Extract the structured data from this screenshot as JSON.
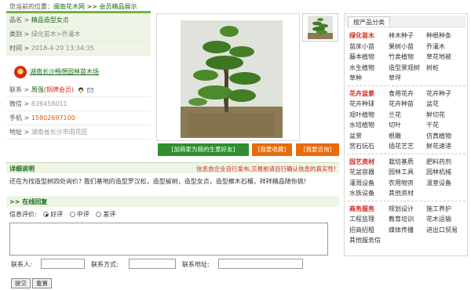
{
  "breadcrumb": {
    "label": "您当前的位置：",
    "site": "闽南花木网",
    "sep": " >> ",
    "current": "会员精品展示"
  },
  "product": {
    "name_key": "品名 >",
    "name_val": "精品造型女贞",
    "category_key": "类别 >",
    "category_val": "绿化苗木>乔灌木",
    "time_key": "时间 >",
    "time_val": "2018-4-20 13:34:35"
  },
  "company": {
    "name": "湖南长沙畅想园林苗木场"
  },
  "contact": {
    "person_key": "联系 >",
    "person_val": "周强",
    "vip_label": "(铜牌会员)",
    "wechat_key": "微信 >",
    "wechat_val": "836458011",
    "phone_key": "手机 >",
    "phone_val": "15802697100",
    "address_key": "地址 >",
    "address_val": "湖南省长沙市雨花区"
  },
  "buttons": {
    "good_friend": "[加商家为我的生意好友]",
    "favorite": "[我要收藏]",
    "inquiry": "[我要咨询]"
  },
  "detail": {
    "title": "详细说明",
    "warning": "信息由企业自行发布,交易前请自行确认信息的真实性!",
    "text": "还在为找造型树四处询价? 我们基地的造型罗汉松，造型榆树，造型女贞，造型檫木石榴，祥祥精品随你挑!"
  },
  "reply": {
    "title": ">> 在线回复",
    "rating_label": "信息评价:",
    "good": "好评",
    "neutral": "中评",
    "bad": "差评",
    "name_label": "联系人:",
    "contact_label": "联系方式:",
    "address_label": "联系地址:",
    "submit": "提交",
    "reset": "重置"
  },
  "categories_tab": "按产品分类",
  "categories": [
    {
      "cells": [
        "绿化苗木",
        "林木种子",
        "种根种条",
        "苗床小苗",
        "果树小苗",
        "乔灌木",
        "藤本植物",
        "竹类植物",
        "草花地被",
        "水生植物",
        "造型景观树",
        "树桩",
        "草种",
        "草坪"
      ]
    },
    {
      "cells": [
        "花卉盆景",
        "食用花卉",
        "花卉种子",
        "花卉种球",
        "花卉种苗",
        "盆花",
        "观叶植物",
        "兰花",
        "鲜切花",
        "水培植物",
        "切叶",
        "干花",
        "盆景",
        "根雕",
        "仿真植物",
        "赏石玩石",
        "插花艺艺",
        "鲜花速递"
      ]
    },
    {
      "cells": [
        "园艺资材",
        "栽培基质",
        "肥料药剂",
        "花盆容器",
        "园林工具",
        "园林机械",
        "灌溉设备",
        "农用物资",
        "温室设备",
        "水族设备",
        "其他资材"
      ]
    },
    {
      "cells": [
        "商务服务",
        "规划设计",
        "施工养护",
        "工程监理",
        "教育培训",
        "花木运输",
        "招商招租",
        "媒体传播",
        "进出口贸易",
        "其他服务信"
      ]
    }
  ],
  "colors": {
    "brand_green": "#1a6a1a",
    "accent_orange": "#e86a0a",
    "warning_red": "#d22a1e",
    "panel_bg": "#eef5e6"
  }
}
